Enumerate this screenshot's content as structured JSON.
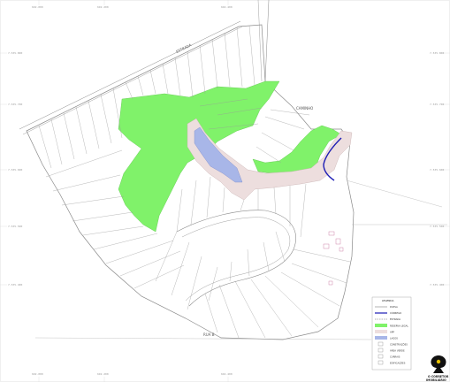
{
  "map": {
    "streets": {
      "north_road": "ESTRADA",
      "east_road": "CAMINHO",
      "south_road": "RUA B"
    },
    "grid_labels": {
      "left": [
        "7.535.800",
        "7.535.700",
        "7.535.600",
        "7.535.500",
        "7.535.400"
      ],
      "right": [
        "7.535.800",
        "7.535.700",
        "7.535.600",
        "7.535.500",
        "7.535.400"
      ],
      "top": [
        "692.000",
        "692.200",
        "692.400"
      ],
      "bottom": [
        "692.000",
        "692.200",
        "692.400"
      ]
    },
    "colors": {
      "reserve": "#80f26a",
      "app": "#eddede",
      "lake": "#a8b6e8",
      "stream": "#1c1cb4",
      "lot_line": "#9a9a9a"
    }
  },
  "legend": {
    "title": "LEGENDA",
    "items": [
      {
        "symbol": "line",
        "label": "DIVISA"
      },
      {
        "symbol": "stream",
        "label": "CÓRREGO"
      },
      {
        "symbol": "dash",
        "label": "ESTRADA"
      },
      {
        "symbol": "reserve",
        "label": "RESERVA LEGAL"
      },
      {
        "symbol": "app",
        "label": "APP"
      },
      {
        "symbol": "lake",
        "label": "LAGOS"
      },
      {
        "symbol": "box",
        "label": "CONSTRUÇÕES"
      },
      {
        "symbol": "box",
        "label": "ÁREA VERDE"
      },
      {
        "symbol": "box",
        "label": "CURRAIS"
      },
      {
        "symbol": "box",
        "label": "EDIFICAÇÕES"
      }
    ]
  },
  "logo": {
    "line1": "O CORRETOR",
    "line2": "IMOBILIÁRIO"
  }
}
